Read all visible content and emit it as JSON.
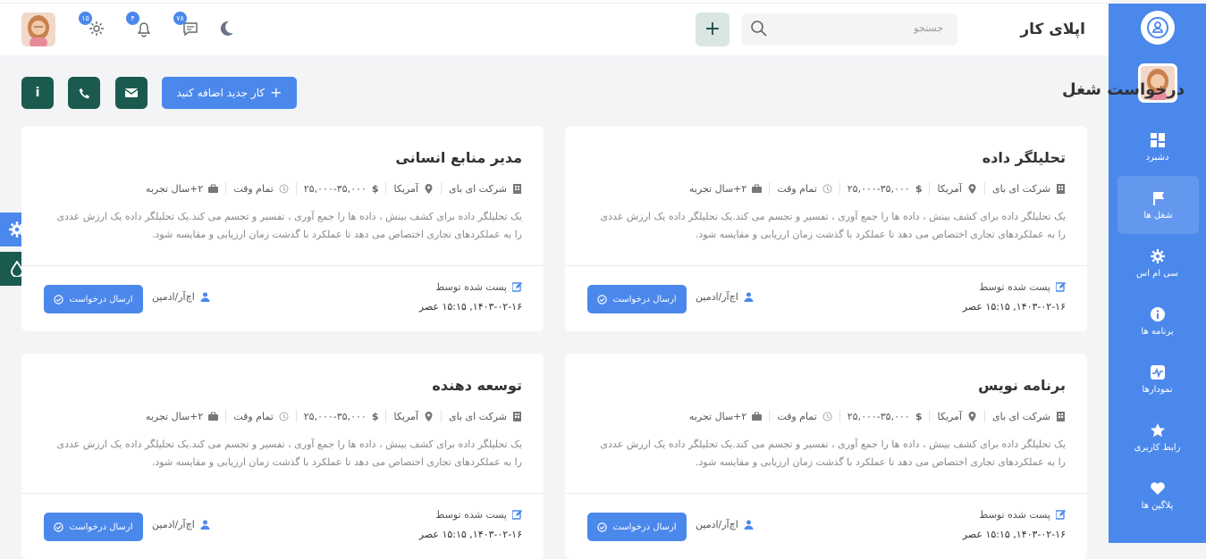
{
  "app": {
    "title": "اپلای کار"
  },
  "header": {
    "search_placeholder": "جستجو",
    "add_label": "+",
    "messages_badge": "۷۸",
    "notifications_badge": "۴",
    "settings_badge": "۱۵"
  },
  "sidebar": {
    "items": [
      {
        "label": "دشبرد",
        "icon": "dashboard-icon"
      },
      {
        "label": "شغل ها",
        "icon": "flag-icon"
      },
      {
        "label": "سی ام اس",
        "icon": "gear-icon"
      },
      {
        "label": "برنامه ها",
        "icon": "info-icon"
      },
      {
        "label": "نمودارها",
        "icon": "chart-icon"
      },
      {
        "label": "رابط کاربری",
        "icon": "star-icon"
      },
      {
        "label": "پلاگین ها",
        "icon": "heart-icon"
      }
    ]
  },
  "page": {
    "title": "درخواست شغل",
    "add_job_label": "کار جدید اضافه کنید",
    "info_label": "i"
  },
  "jobs": [
    {
      "title": "تحلیلگر داده",
      "company": "شرکت ای بای",
      "location": "آمریکا",
      "salary": "۲۵,۰۰۰-۳۵,۰۰۰",
      "type": "تمام وقت",
      "experience": "۲+سال تجربه",
      "desc1": "یک تحلیلگر داده برای کشف بینش ، داده ها را جمع آوری ، تفسیر و تجسم می کند.یک تحلیلگر داده یک ارزش عددی",
      "desc2": "را به عملکردهای تجاری اختصاص می دهد تا عملکرد با گذشت زمان ارزیابی و مقایسه شود.",
      "posted_by": "پست شده توسط",
      "date": "۱۴۰۳-۰۲-۱۶, ۱۵:۱۵ عصر",
      "author": "اچ‌آر/ادمین",
      "apply": "ارسال درخواست"
    },
    {
      "title": "مدیر منابع انسانی",
      "company": "شرکت ای بای",
      "location": "آمریکا",
      "salary": "۲۵,۰۰۰-۳۵,۰۰۰",
      "type": "تمام وقت",
      "experience": "۲+سال تجربه",
      "desc1": "یک تحلیلگر داده برای کشف بینش ، داده ها را جمع آوری ، تفسیر و تجسم می کند.یک تحلیلگر داده یک ارزش عددی",
      "desc2": "را به عملکردهای تجاری اختصاص می دهد تا عملکرد با گذشت زمان ارزیابی و مقایسه شود.",
      "posted_by": "پست شده توسط",
      "date": "۱۴۰۳-۰۲-۱۶, ۱۵:۱۵ عصر",
      "author": "اچ‌آر/ادمین",
      "apply": "ارسال درخواست"
    },
    {
      "title": "برنامه نویس",
      "company": "شرکت ای بای",
      "location": "آمریکا",
      "salary": "۲۵,۰۰۰-۳۵,۰۰۰",
      "type": "تمام وقت",
      "experience": "۲+سال تجربه",
      "desc1": "یک تحلیلگر داده برای کشف بینش ، داده ها را جمع آوری ، تفسیر و تجسم می کند.یک تحلیلگر داده یک ارزش عددی",
      "desc2": "را به عملکردهای تجاری اختصاص می دهد تا عملکرد با گذشت زمان ارزیابی و مقایسه شود.",
      "posted_by": "پست شده توسط",
      "date": "۱۴۰۳-۰۲-۱۶, ۱۵:۱۵ عصر",
      "author": "اچ‌آر/ادمین",
      "apply": "ارسال درخواست"
    },
    {
      "title": "توسعه دهنده",
      "company": "شرکت ای بای",
      "location": "آمریکا",
      "salary": "۲۵,۰۰۰-۳۵,۰۰۰",
      "type": "تمام وقت",
      "experience": "۲+سال تجربه",
      "desc1": "یک تحلیلگر داده برای کشف بینش ، داده ها را جمع آوری ، تفسیر و تجسم می کند.یک تحلیلگر داده یک ارزش عددی",
      "desc2": "را به عملکردهای تجاری اختصاص می دهد تا عملکرد با گذشت زمان ارزیابی و مقایسه شود.",
      "posted_by": "پست شده توسط",
      "date": "۱۴۰۳-۰۲-۱۶, ۱۵:۱۵ عصر",
      "author": "اچ‌آر/ادمین",
      "apply": "ارسال درخواست"
    }
  ],
  "colors": {
    "primary": "#4b88ec",
    "dark_green": "#1b5a4f",
    "background": "#f3f4f6"
  }
}
